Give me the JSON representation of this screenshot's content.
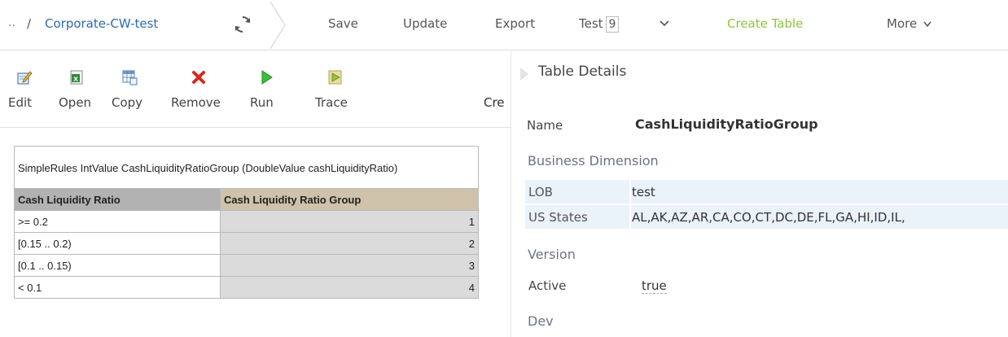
{
  "breadcrumb": {
    "ellipsis": "..",
    "separator": "/",
    "project": "Corporate-CW-test"
  },
  "menu": {
    "save": "Save",
    "update": "Update",
    "export": "Export",
    "test": "Test",
    "test_count": "9",
    "create_table": "Create Table",
    "more": "More"
  },
  "toolbar": {
    "edit": "Edit",
    "open": "Open",
    "copy": "Copy",
    "remove": "Remove",
    "run": "Run",
    "trace": "Trace",
    "create_truncated": "Cre"
  },
  "rules_table": {
    "caption": "SimpleRules IntValue CashLiquidityRatioGroup (DoubleValue cashLiquidityRatio)",
    "headers": [
      "Cash Liquidity Ratio",
      "Cash Liquidity Ratio Group"
    ],
    "rows": [
      [
        ">= 0.2",
        "1"
      ],
      [
        "[0.15 .. 0.2)",
        "2"
      ],
      [
        "[0.1 .. 0.15)",
        "3"
      ],
      [
        "< 0.1",
        "4"
      ]
    ]
  },
  "details": {
    "title": "Table Details",
    "name_label": "Name",
    "name_value": "CashLiquidityRatioGroup",
    "business_dimension": "Business Dimension",
    "lob_label": "LOB",
    "lob_value": "test",
    "states_label": "US States",
    "states_value": "AL,AK,AZ,AR,CA,CO,CT,DC,DE,FL,GA,HI,ID,IL,",
    "version": "Version",
    "active_label": "Active",
    "active_value": "true",
    "dev": "Dev"
  },
  "colors": {
    "link": "#2a6bb0",
    "create_table": "#8cc63f",
    "header_gray": "#b2b2b2",
    "header_tan": "#cec2aa",
    "value_cell": "#dbdbdb",
    "prop_row": "#eaf2fa"
  },
  "icons": [
    "refresh-icon",
    "edit-icon",
    "excel-open-icon",
    "copy-table-icon",
    "remove-x-icon",
    "run-play-icon",
    "trace-icon",
    "chevron-down-icon",
    "expand-arrow-icon"
  ]
}
